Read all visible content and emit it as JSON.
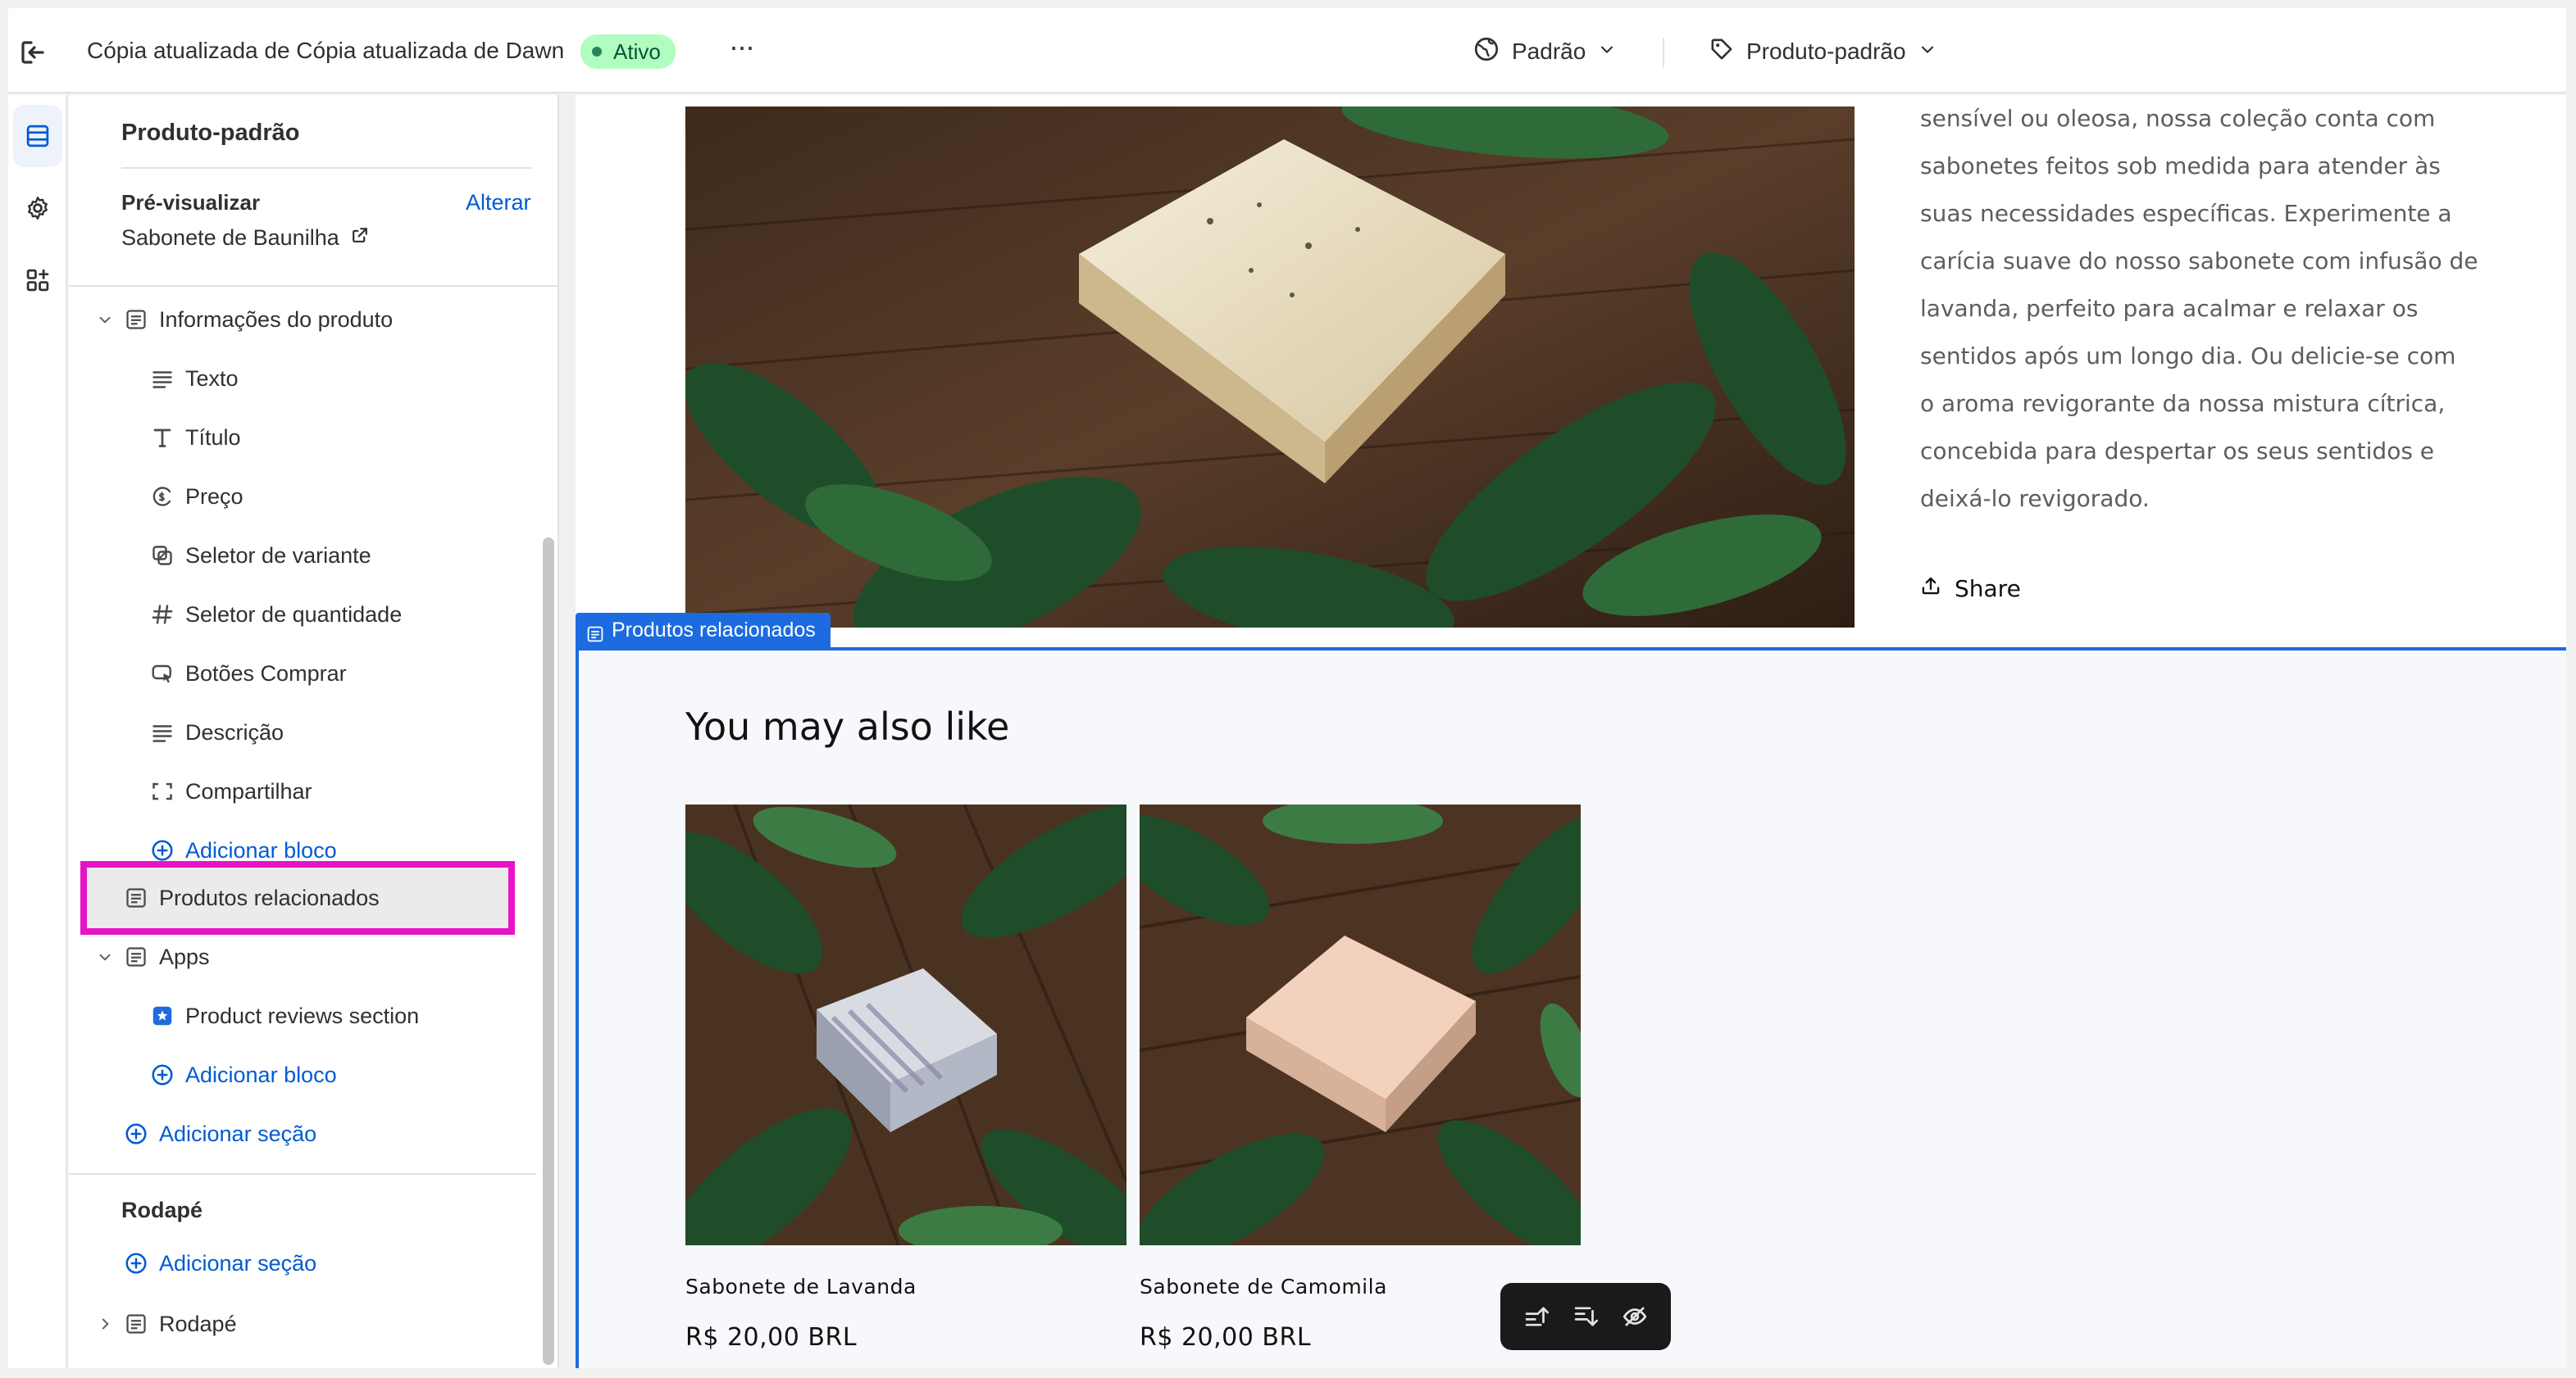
{
  "topbar": {
    "theme_title": "Cópia atualizada de Cópia atualizada de Dawn",
    "status_badge": "Ativo",
    "more_label": "···",
    "market_selector": "Padrão",
    "template_selector": "Produto-padrão"
  },
  "sidebar": {
    "template_name": "Produto-padrão",
    "preview": {
      "label": "Pré-visualizar",
      "change_link": "Alterar",
      "product": "Sabonete de Baunilha"
    },
    "tree": [
      {
        "label": "Informações do produto",
        "icon": "section-icon",
        "expanded": true
      },
      {
        "label": "Texto",
        "icon": "text-icon"
      },
      {
        "label": "Título",
        "icon": "title-icon"
      },
      {
        "label": "Preço",
        "icon": "price-icon"
      },
      {
        "label": "Seletor de variante",
        "icon": "variant-icon"
      },
      {
        "label": "Seletor de quantidade",
        "icon": "hash-icon"
      },
      {
        "label": "Botões Comprar",
        "icon": "buy-button-icon"
      },
      {
        "label": "Descrição",
        "icon": "description-icon"
      },
      {
        "label": "Compartilhar",
        "icon": "share-frame-icon"
      },
      {
        "label": "Adicionar bloco",
        "icon": "add-circle-icon"
      },
      {
        "label": "Produtos relacionados",
        "icon": "section-icon",
        "selected": true
      },
      {
        "label": "Apps",
        "icon": "section-icon",
        "expanded": true
      },
      {
        "label": "Product reviews section",
        "icon": "app-icon"
      },
      {
        "label": "Adicionar bloco",
        "icon": "add-circle-icon"
      },
      {
        "label": "Adicionar seção",
        "icon": "add-circle-icon"
      }
    ],
    "footer": {
      "label": "Rodapé",
      "add_section": "Adicionar seção",
      "section": "Rodapé"
    }
  },
  "preview": {
    "description_lines": [
      "sensível ou oleosa, nossa coleção conta com",
      "sabonetes feitos sob medida para atender às",
      "suas necessidades específicas. Experimente a",
      "carícia suave do nosso sabonete com infusão de",
      "lavanda, perfeito para acalmar e relaxar os",
      "sentidos após um longo dia. Ou delicie-se com",
      "o aroma revigorante da nossa mistura cítrica,",
      "concebida para despertar os seus sentidos e",
      "deixá-lo revigorado."
    ],
    "share_label": "Share",
    "section_tag": "Produtos relacionados",
    "related_heading": "You may also like",
    "products": [
      {
        "name": "Sabonete de Lavanda",
        "price": "R$ 20,00 BRL"
      },
      {
        "name": "Sabonete de Camomila",
        "price": "R$ 20,00 BRL"
      }
    ]
  },
  "colors": {
    "accent": "#005bd3",
    "selection_outline": "#e614c6",
    "section_outline": "#1c6be0",
    "badge_bg": "#affebf"
  }
}
